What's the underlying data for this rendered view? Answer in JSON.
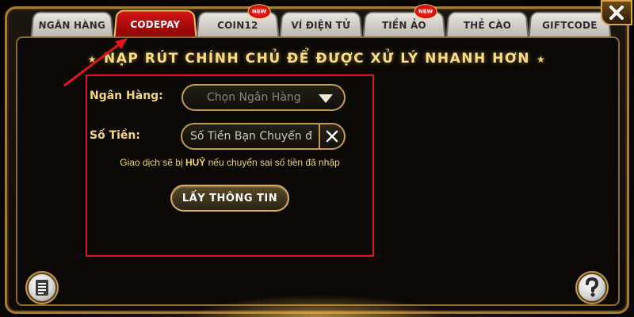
{
  "tabs": [
    {
      "label": "NGÂN HÀNG",
      "active": false,
      "badge": ""
    },
    {
      "label": "CODEPAY",
      "active": true,
      "badge": ""
    },
    {
      "label": "COIN12",
      "active": false,
      "badge": "NEW"
    },
    {
      "label": "VÍ ĐIỆN TỬ",
      "active": false,
      "badge": ""
    },
    {
      "label": "TIỀN ẢO",
      "active": false,
      "badge": "NEW"
    },
    {
      "label": "THẺ CÀO",
      "active": false,
      "badge": ""
    },
    {
      "label": "GIFTCODE",
      "active": false,
      "badge": ""
    }
  ],
  "heading": "NẠP RÚT CHÍNH CHỦ ĐỂ ĐƯỢC XỬ LÝ NHANH HƠN",
  "form": {
    "bank_label": "Ngân Hàng:",
    "bank_select": "Chọn Ngân Hàng",
    "amount_label": "Số Tiền:",
    "amount_placeholder": "Số Tiền Bạn Chuyển đ",
    "notice_prefix": "Giao dịch sẽ bị ",
    "notice_emphasis": "HUỶ",
    "notice_suffix": " nếu chuyển sai số tiền đã nhập",
    "submit_label": "LẤY THÔNG TIN"
  },
  "colors": {
    "accent_gold": "#f5d77a",
    "active_tab": "#c00f0f",
    "highlight_box": "#e0141d"
  },
  "icons": {
    "close": "close-icon",
    "history": "list-document-icon",
    "help": "question-mark-icon",
    "dropdown": "caret-down-icon",
    "clear": "x-icon"
  }
}
